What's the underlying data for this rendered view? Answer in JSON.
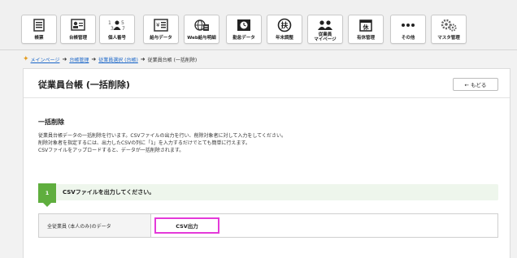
{
  "toolbar": {
    "items": [
      {
        "label": "帳票",
        "icon": "report-icon"
      },
      {
        "label": "台帳管理",
        "icon": "ledger-icon"
      },
      {
        "label": "個人番号",
        "icon": "mynumber-icon"
      },
      {
        "label": "給与データ",
        "icon": "payroll-data-icon"
      },
      {
        "label": "Web給与明細",
        "icon": "web-payslip-icon"
      },
      {
        "label": "勤怠データ",
        "icon": "attendance-icon"
      },
      {
        "label": "年末調整",
        "icon": "year-end-adjustment-icon"
      },
      {
        "label": "従業員マイページ",
        "icon": "employee-mypage-icon",
        "line1": "従業員",
        "line2": "マイページ"
      },
      {
        "label": "有休管理",
        "icon": "paid-leave-icon",
        "badge": "休"
      },
      {
        "label": "その他",
        "icon": "more-icon"
      },
      {
        "label": "マスタ管理",
        "icon": "master-settings-icon"
      }
    ]
  },
  "breadcrumb": {
    "items": [
      "メインページ",
      "台帳管理",
      "従業員選択 (台帳)"
    ],
    "current": "従業員台帳 (一括削除)"
  },
  "page": {
    "title": "従業員台帳 (一括削除)",
    "back_label": "← もどる"
  },
  "section": {
    "title": "一括削除",
    "desc1": "従業員台帳データの一括削除を行います。CSVファイルの出力を行い、削除対象者に対して入力をしてください。",
    "desc2": "削除対象者を指定するには、出力したCSVの列に「1」を入力するだけでとても簡単に行えます。",
    "desc3": "CSVファイルをアップロードすると、データが一括削除されます。"
  },
  "step": {
    "number": "1",
    "text": "CSVファイルを出力してください。"
  },
  "output": {
    "label": "全従業員 (本人のみ)のデータ",
    "button_label": "CSV出力"
  },
  "colors": {
    "step_green": "#5fae3e",
    "highlight_magenta": "#e43ad9",
    "link_blue": "#1a66c8"
  }
}
